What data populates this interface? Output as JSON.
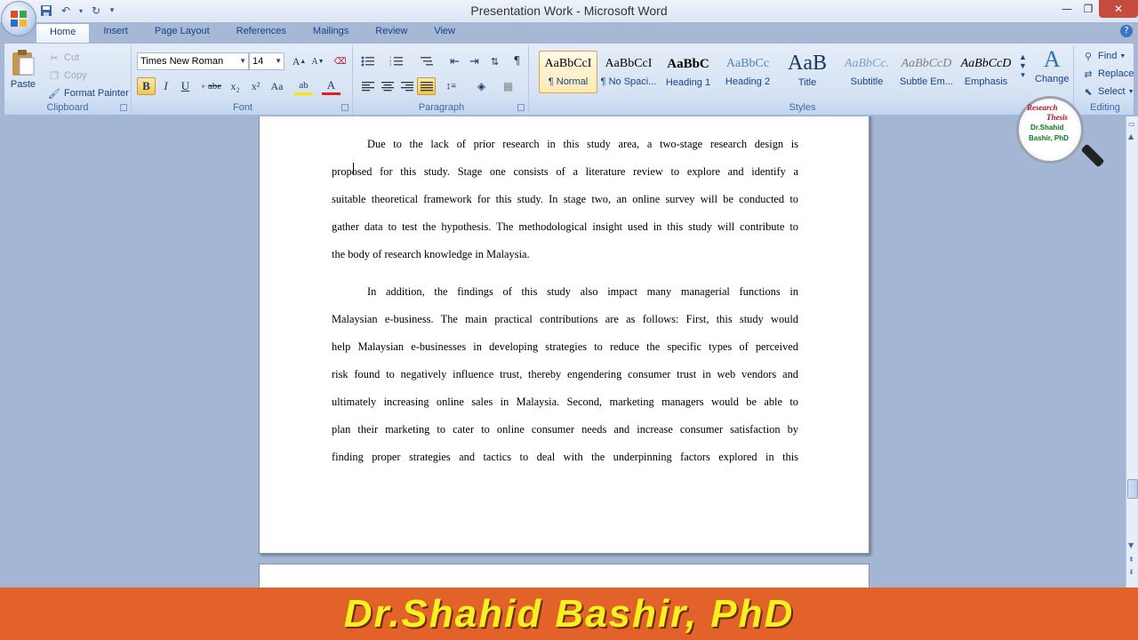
{
  "window": {
    "title": "Presentation Work - Microsoft Word"
  },
  "tabs": [
    "Home",
    "Insert",
    "Page Layout",
    "References",
    "Mailings",
    "Review",
    "View"
  ],
  "clipboard": {
    "paste": "Paste",
    "cut": "Cut",
    "copy": "Copy",
    "format_painter": "Format Painter",
    "label": "Clipboard"
  },
  "font": {
    "name": "Times New Roman",
    "size": "14",
    "label": "Font",
    "bold": "B",
    "italic": "I",
    "underline": "U",
    "strike": "abe",
    "subscript": "x₂",
    "superscript": "x²",
    "change_case": "Aa",
    "highlight": "ab",
    "font_color": "A",
    "grow": "A",
    "shrink": "A"
  },
  "paragraph": {
    "label": "Paragraph"
  },
  "styles": {
    "label": "Styles",
    "items": [
      {
        "sample": "AaBbCcI",
        "name": "¶ Normal"
      },
      {
        "sample": "AaBbCcI",
        "name": "¶ No Spaci..."
      },
      {
        "sample": "AaBbC",
        "name": "Heading 1"
      },
      {
        "sample": "AaBbCc",
        "name": "Heading 2"
      },
      {
        "sample": "AaB",
        "name": "Title"
      },
      {
        "sample": "AaBbCc.",
        "name": "Subtitle"
      },
      {
        "sample": "AaBbCcD",
        "name": "Subtle Em..."
      },
      {
        "sample": "AaBbCcD",
        "name": "Emphasis"
      }
    ],
    "change_styles": "Change"
  },
  "editing": {
    "label": "Editing",
    "find": "Find",
    "replace": "Replace",
    "select": "Select"
  },
  "document": {
    "paragraph1": [
      "Due to the lack of prior research in this study area, a two-stage research design is",
      "proposed for this study. Stage one consists of a literature review to explore and identify a",
      "suitable theoretical framework for this study. In stage two, an online survey will be conducted to",
      "gather data to test the hypothesis. The methodological insight used in this study will contribute to",
      "the body of research knowledge in Malaysia."
    ],
    "paragraph2": [
      "In addition, the findings of this study also impact many managerial functions in",
      "Malaysian e-business. The main practical contributions are as follows: First, this study would",
      "help Malaysian e-businesses in developing strategies to reduce the specific types of perceived",
      "risk found to negatively influence trust, thereby engendering consumer trust in web vendors and",
      "ultimately increasing online sales in Malaysia. Second, marketing managers would be able to",
      "plan their marketing to cater to online consumer needs and increase consumer satisfaction by",
      "finding proper strategies and tactics to deal with the underpinning factors explored in this"
    ]
  },
  "logo": {
    "line1": "Research",
    "line2": "Thesis",
    "line3": "Dr.Shahid",
    "line4": "Bashir, PhD"
  },
  "banner": {
    "text": "Dr.Shahid  Bashir,  PhD"
  },
  "colors": {
    "banner_bg": "#e2622a",
    "banner_text": "#f7f21b",
    "ribbon_accent": "#15428b"
  }
}
